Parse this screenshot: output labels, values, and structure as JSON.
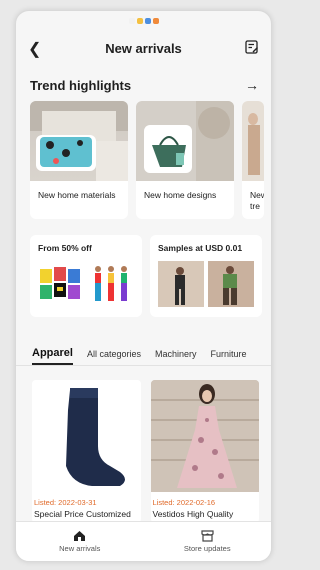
{
  "header": {
    "title": "New arrivals",
    "back_icon": "chevron-left-icon",
    "edit_icon": "edit-note-icon"
  },
  "trend": {
    "title": "Trend highlights",
    "items": [
      {
        "label": "New home materials"
      },
      {
        "label": "New home designs"
      },
      {
        "label": "New tre"
      }
    ]
  },
  "promos": [
    {
      "label": "From 50% off"
    },
    {
      "label": "Samples at USD 0.01"
    }
  ],
  "category_tabs": [
    "Apparel",
    "All categories",
    "Machinery",
    "Furniture"
  ],
  "products": [
    {
      "listed": "Listed: 2022-03-31",
      "name": "Special Price Customized"
    },
    {
      "listed": "Listed: 2022-02-16",
      "name": "Vestidos High Quality"
    }
  ],
  "tabbar": [
    {
      "label": "New arrivals",
      "icon": "home-icon"
    },
    {
      "label": "Store updates",
      "icon": "store-icon"
    }
  ],
  "colors": {
    "accent": "#e06a2a"
  }
}
